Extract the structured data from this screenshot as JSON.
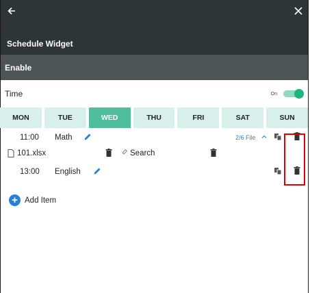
{
  "header": {
    "title": "Schedule Widget"
  },
  "enable": {
    "label": "Enable"
  },
  "time": {
    "label": "Time",
    "toggle_state": "On",
    "enabled": true
  },
  "days": [
    "MON",
    "TUE",
    "WED",
    "THU",
    "FRI",
    "SAT",
    "SUN"
  ],
  "active_day": "WED",
  "items": [
    {
      "time": "11:00",
      "subject": "Math",
      "file_count": "2/6 File",
      "file": {
        "name": "101.xlsx",
        "search_label": "Search"
      }
    },
    {
      "time": "13:00",
      "subject": "English"
    }
  ],
  "add_item_label": "Add Item",
  "colors": {
    "header": "#2f3436",
    "enable_bar": "#4e5355",
    "accent": "#1fb57e",
    "day_active": "#4fbe9b",
    "day_inactive": "#d7f1ea",
    "link": "#2a88d8",
    "highlight": "#e10000"
  },
  "icons": [
    "back-arrow-icon",
    "close-icon",
    "edit-pencil-icon",
    "chevron-up-icon",
    "copy-icon",
    "trash-icon",
    "file-icon",
    "link-icon",
    "add-icon"
  ]
}
